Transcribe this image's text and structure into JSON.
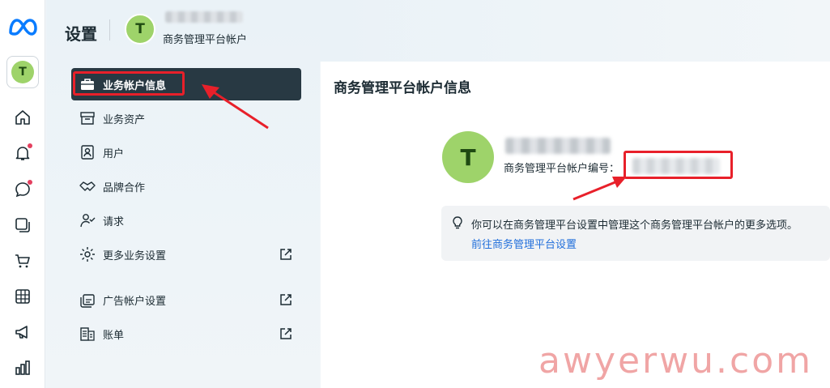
{
  "header": {
    "title": "设置",
    "account_initial": "T",
    "account_subtitle": "商务管理平台帐户"
  },
  "rail": {
    "account_initial": "T",
    "icons": [
      "home-icon",
      "bell-icon",
      "chat-icon",
      "pages-icon",
      "cart-icon",
      "table-icon",
      "megaphone-icon",
      "chart-icon"
    ]
  },
  "sidebar": {
    "items": [
      {
        "label": "业务帐户信息",
        "icon": "briefcase-icon",
        "active": true
      },
      {
        "label": "业务资产",
        "icon": "archive-icon"
      },
      {
        "label": "用户",
        "icon": "user-card-icon"
      },
      {
        "label": "品牌合作",
        "icon": "handshake-icon"
      },
      {
        "label": "请求",
        "icon": "user-check-icon"
      },
      {
        "label": "更多业务设置",
        "icon": "gear-icon",
        "external": true
      },
      {
        "label": "广告帐户设置",
        "icon": "ad-account-icon",
        "external": true
      },
      {
        "label": "账单",
        "icon": "billing-icon",
        "external": true
      }
    ]
  },
  "main": {
    "title": "商务管理平台帐户信息",
    "avatar_initial": "T",
    "id_label": "商务管理平台帐户编号：",
    "info_text": "你可以在商务管理平台设置中管理这个商务管理平台帐户的更多选项。",
    "info_link": "前往商务管理平台设置"
  },
  "watermark": "awyerwu.com",
  "colors": {
    "accent_dark": "#283943",
    "link": "#216fdb",
    "avatar": "#9ed36a",
    "annotation_red": "#e8202a"
  }
}
